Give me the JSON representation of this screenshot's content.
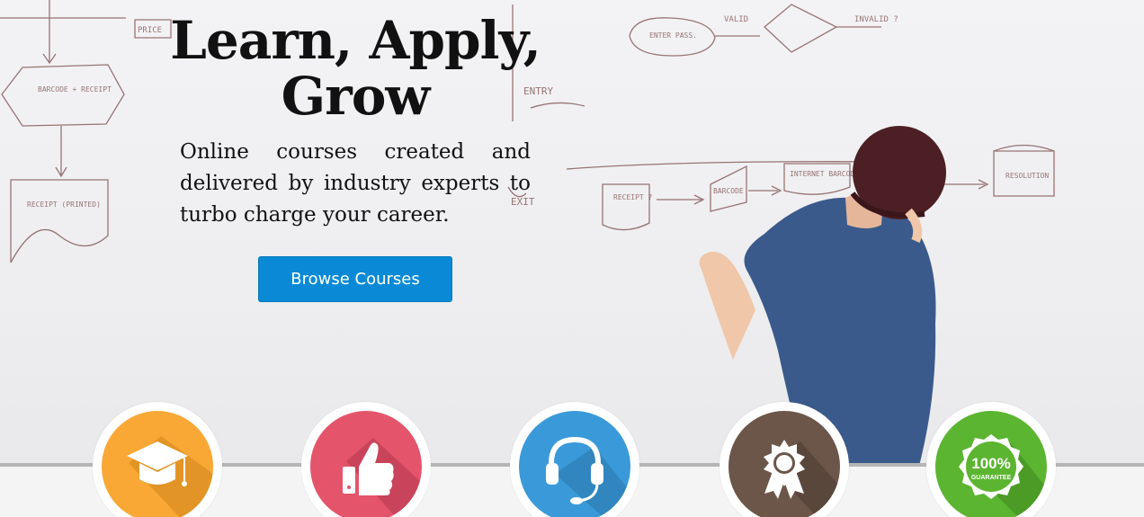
{
  "hero": {
    "headline": "Learn, Apply, Grow",
    "tagline": "Online courses created and delivered by industry experts to turbo charge your career.",
    "button_label": "Browse Courses"
  },
  "whiteboard_notes": [
    "PRICE",
    "BARCODE + RECEIPT",
    "RECEIPT (PRINTED)",
    "ENTRY",
    "ENTER PASS.",
    "VALID",
    "INVALID ?",
    "RECEIPT ?",
    "BARCODE",
    "INTERNET BARCODE",
    "RESOLUTION",
    "EXIT"
  ],
  "features": [
    {
      "icon": "graduation-cap-icon",
      "color": "#f9a835"
    },
    {
      "icon": "thumbs-up-icon",
      "color": "#e4546a"
    },
    {
      "icon": "headset-icon",
      "color": "#3a9ad9"
    },
    {
      "icon": "award-badge-icon",
      "color": "#6b5649"
    },
    {
      "icon": "guarantee-seal-icon",
      "color": "#5cb531",
      "badge_top": "100%",
      "badge_bottom": "GUARANTEE"
    }
  ],
  "colors": {
    "button": "#0a8ad6",
    "text": "#111111"
  }
}
